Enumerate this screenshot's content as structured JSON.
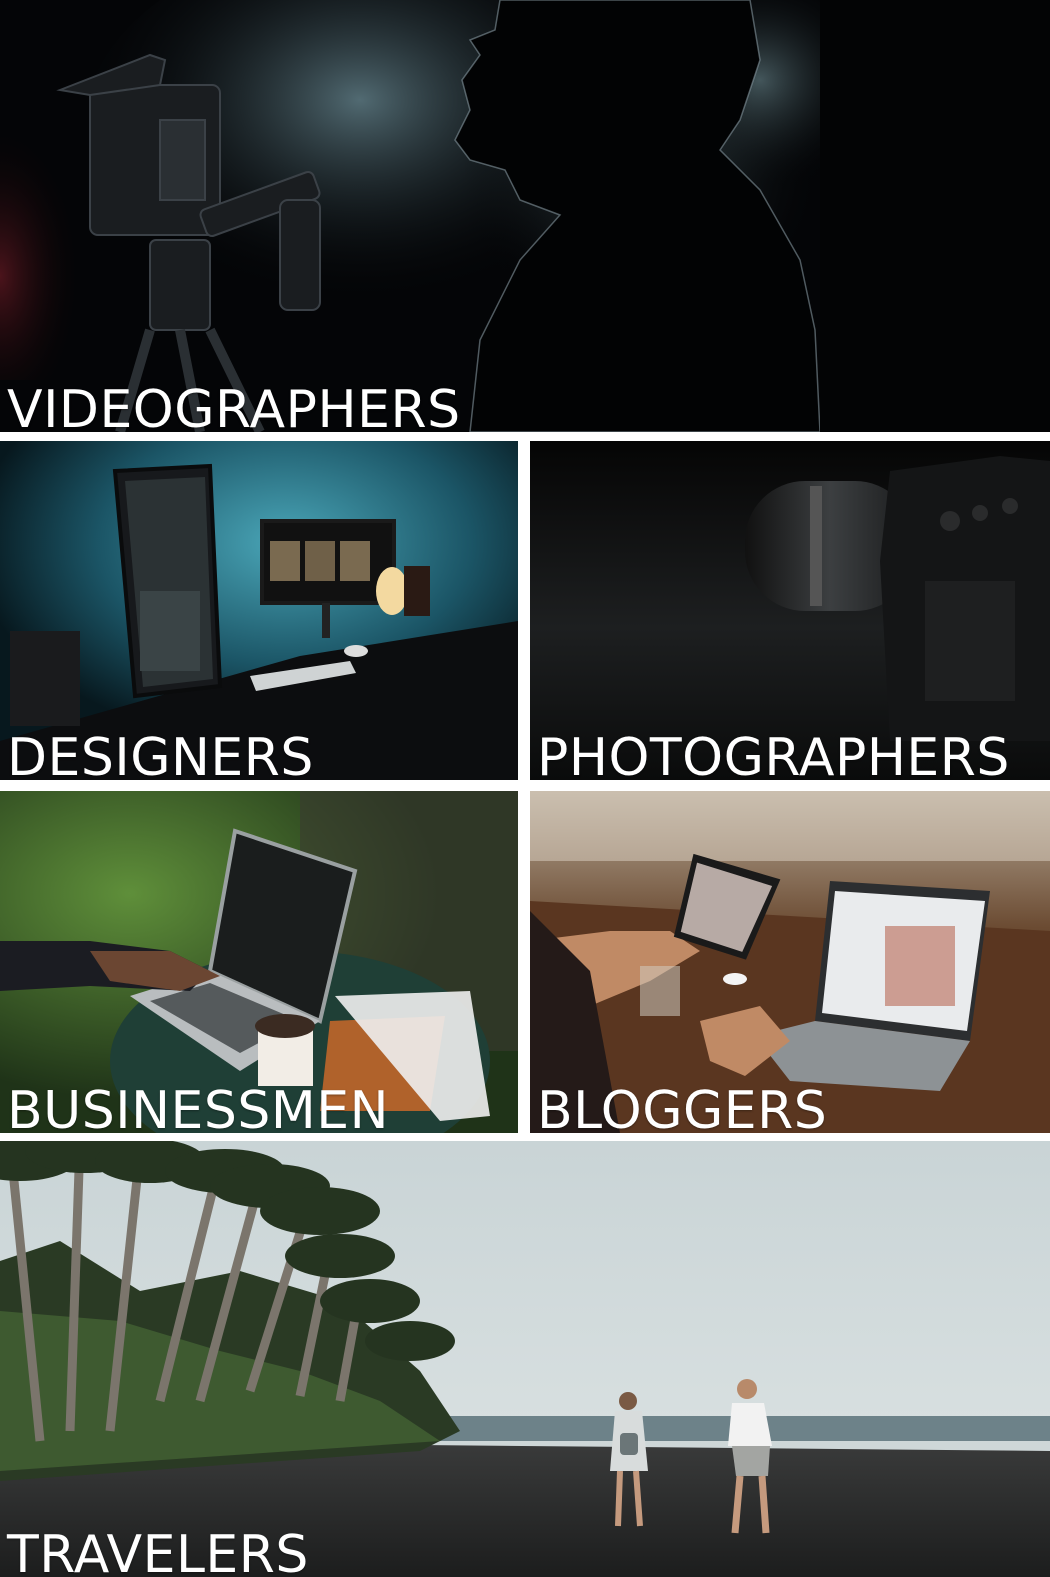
{
  "tiles": {
    "videographers": {
      "label": "VIDEOGRAPHERS"
    },
    "designers": {
      "label": "DESIGNERS"
    },
    "photographers": {
      "label": "PHOTOGRAPHERS"
    },
    "businessmen": {
      "label": "BUSINESSMEN"
    },
    "bloggers": {
      "label": "BLOGGERS"
    },
    "travelers": {
      "label": "TRAVELERS"
    }
  }
}
